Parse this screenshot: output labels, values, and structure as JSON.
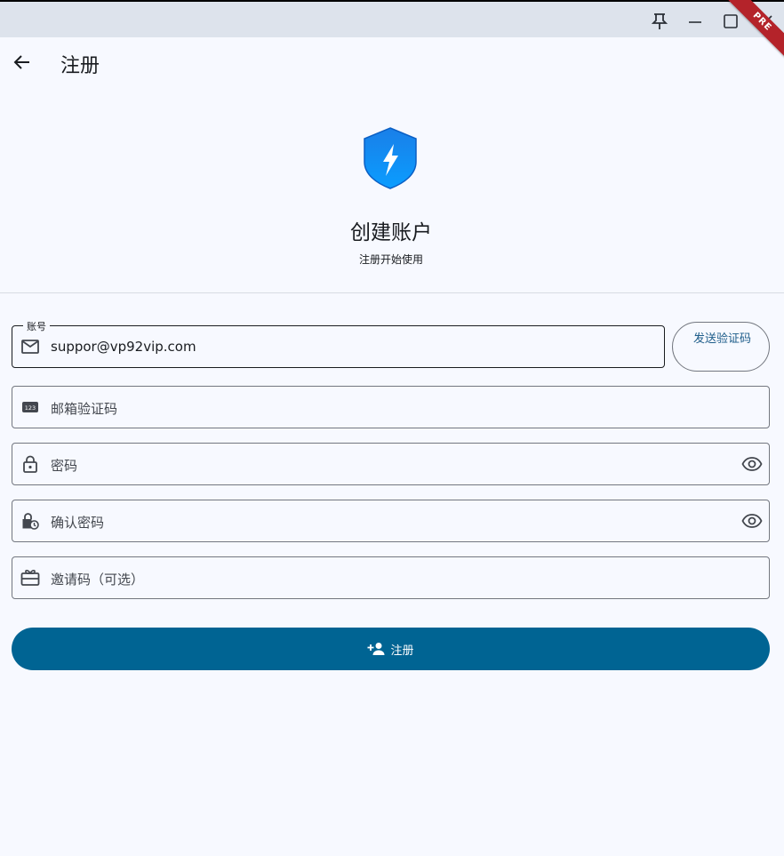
{
  "window": {
    "controls": [
      "pin-icon",
      "minimize-icon",
      "maximize-icon",
      "close-icon"
    ],
    "badge": "PRE",
    "badge_color": "#b4232a"
  },
  "appbar": {
    "title": "注册",
    "back_icon": "arrow-back-icon"
  },
  "hero": {
    "logo_icon": "shield-bolt-icon",
    "title": "创建账户",
    "subtitle": "注册开始使用"
  },
  "form": {
    "account": {
      "label": "账号",
      "value": "suppor@vp92vip.com",
      "icon": "mail-icon"
    },
    "send_code_label": "发送验证码",
    "email_code": {
      "placeholder": "邮箱验证码",
      "icon": "pin-123-icon"
    },
    "password": {
      "placeholder": "密码",
      "icon": "lock-icon",
      "toggle_icon": "eye-icon"
    },
    "confirm_password": {
      "placeholder": "确认密码",
      "icon": "lock-clock-icon",
      "toggle_icon": "eye-icon"
    },
    "invite_code": {
      "placeholder": "邀请码（可选）",
      "icon": "card-giftcard-icon"
    },
    "submit_label": "注册",
    "submit_icon": "person-add-icon"
  },
  "colors": {
    "primary": "#006493",
    "background": "#f7f9ff",
    "titlebar": "#dde3ec",
    "outline": "#73777f"
  }
}
